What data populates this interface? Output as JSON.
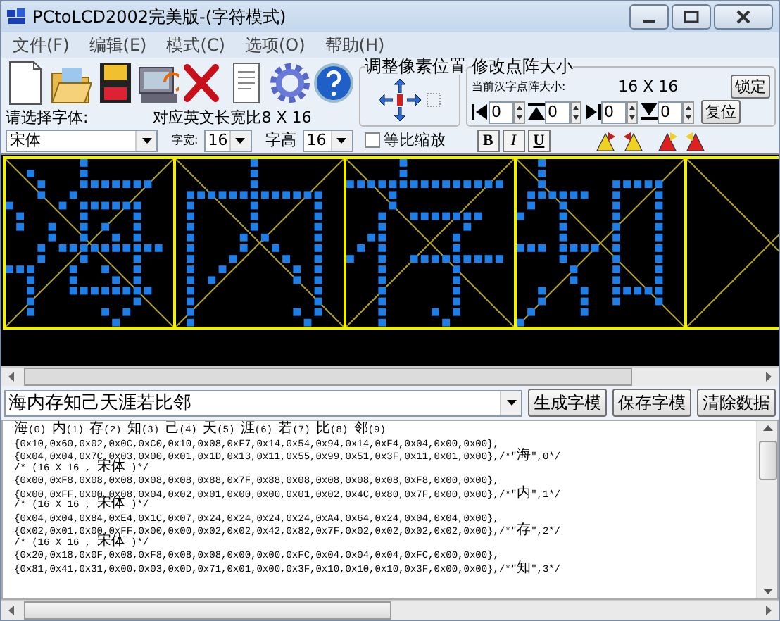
{
  "window": {
    "title": "PCtoLCD2002完美版-(字符模式)"
  },
  "menu": [
    "文件(F)",
    "编辑(E)",
    "模式(C)",
    "选项(O)",
    "帮助(H)"
  ],
  "font": {
    "label": "请选择字体:",
    "value": "宋体"
  },
  "ratio_label": "对应英文长宽比8 X 16",
  "char_width": {
    "label": "字宽:",
    "value": "16"
  },
  "char_height": {
    "label": "字高",
    "value": "16"
  },
  "proportional": {
    "label": "等比缩放",
    "checked": false
  },
  "style_buttons": [
    "B",
    "I",
    "U"
  ],
  "pixel_shift": {
    "title": "调整像素位置"
  },
  "matrix_size": {
    "title": "修改点阵大小",
    "current_label": "当前汉字点阵大小:",
    "current_value": "16 X 16",
    "lock_button": "锁定",
    "reset_button": "复位",
    "offsets": [
      "0",
      "0",
      "0",
      "0"
    ]
  },
  "input": {
    "value": "海内存知己天涯若比邻"
  },
  "buttons": [
    "生成字模",
    "保存字模",
    "清除数据"
  ],
  "output": {
    "index_line": "海(0) 内(1) 存(2) 知(3) 己(4) 天(5) 涯(6) 若(7) 比(8) 邻(9)",
    "blocks": [
      {
        "lines": [
          "{0x10,0x60,0x02,0x0C,0xC0,0x10,0x08,0xF7,0x14,0x54,0x94,0x14,0xF4,0x04,0x00,0x00},",
          "{0x04,0x04,0x7C,0x03,0x00,0x01,0x1D,0x13,0x11,0x55,0x99,0x51,0x3F,0x11,0x01,0x00},/*\"海\",0*/",
          "/* (16 X 16 , 宋体 )*/"
        ]
      },
      {
        "lines": [
          "{0x00,0xF8,0x08,0x08,0x08,0x08,0x88,0x7F,0x88,0x08,0x08,0x08,0x08,0xF8,0x00,0x00},",
          "{0x00,0xFF,0x00,0x08,0x04,0x02,0x01,0x00,0x00,0x01,0x02,0x4C,0x80,0x7F,0x00,0x00},/*\"内\",1*/",
          "/* (16 X 16 , 宋体 )*/"
        ]
      },
      {
        "lines": [
          "{0x04,0x04,0x84,0xE4,0x1C,0x07,0x24,0x24,0x24,0x24,0xA4,0x64,0x24,0x04,0x04,0x00},",
          "{0x02,0x01,0x00,0xFF,0x00,0x00,0x02,0x02,0x42,0x82,0x7F,0x02,0x02,0x02,0x02,0x00},/*\"存\",2*/",
          "/* (16 X 16 , 宋体 )*/"
        ]
      },
      {
        "lines": [
          "{0x20,0x18,0x0F,0x08,0xF8,0x08,0x08,0x00,0x00,0xFC,0x04,0x04,0x04,0xFC,0x00,0x00},",
          "{0x81,0x41,0x31,0x00,0x03,0x0D,0x71,0x01,0x00,0x3F,0x10,0x10,0x10,0x3F,0x00,0x00},/*\"知\",3*/"
        ]
      }
    ]
  }
}
